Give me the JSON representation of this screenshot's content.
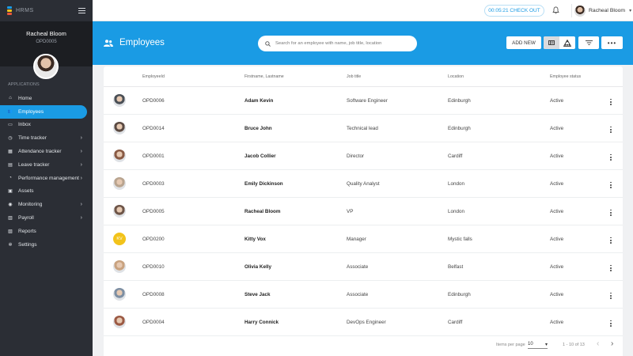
{
  "app": {
    "name": "HRMS"
  },
  "profile": {
    "name": "Racheal Bloom",
    "id": "OPD0005"
  },
  "sidebar": {
    "section": "APPLICATIONS",
    "items": [
      {
        "label": "Home",
        "icon": "home-icon",
        "arrow": false,
        "active": false
      },
      {
        "label": "Employees",
        "icon": "people-icon",
        "arrow": false,
        "active": true
      },
      {
        "label": "Inbox",
        "icon": "inbox-icon",
        "arrow": false,
        "active": false
      },
      {
        "label": "Time tracker",
        "icon": "clock-icon",
        "arrow": true,
        "active": false
      },
      {
        "label": "Attendance tracker",
        "icon": "calendar-icon",
        "arrow": true,
        "active": false
      },
      {
        "label": "Leave tracker",
        "icon": "leave-icon",
        "arrow": true,
        "active": false
      },
      {
        "label": "Performance management",
        "icon": "performance-icon",
        "arrow": true,
        "active": false
      },
      {
        "label": "Assets",
        "icon": "assets-icon",
        "arrow": false,
        "active": false
      },
      {
        "label": "Monitoring",
        "icon": "eye-icon",
        "arrow": true,
        "active": false
      },
      {
        "label": "Payroll",
        "icon": "payroll-icon",
        "arrow": true,
        "active": false
      },
      {
        "label": "Reports",
        "icon": "reports-icon",
        "arrow": false,
        "active": false
      },
      {
        "label": "Settings",
        "icon": "gear-icon",
        "arrow": false,
        "active": false
      }
    ]
  },
  "topbar": {
    "checkout_time": "00:05:21",
    "checkout_label": "CHECK OUT",
    "user_name": "Racheal Bloom"
  },
  "header": {
    "title": "Employees",
    "search_placeholder": "Search for an employee with name, job title, location",
    "add_new": "ADD NEW"
  },
  "table": {
    "headers": [
      "EmployeeId",
      "Firstname, Lastname",
      "Job title",
      "Location",
      "Employee status"
    ],
    "rows": [
      {
        "id": "OPD0006",
        "name": "Adam Kevin",
        "job": "Software Engineer",
        "location": "Edinburgh",
        "status": "Active",
        "avatar_color": "#4a4f55",
        "initials": ""
      },
      {
        "id": "OPD0014",
        "name": "Bruce John",
        "job": "Technical lead",
        "location": "Edinburgh",
        "status": "Active",
        "avatar_color": "#5b4a42",
        "initials": ""
      },
      {
        "id": "OPD0001",
        "name": "Jacob Collier",
        "job": "Director",
        "location": "Cardiff",
        "status": "Active",
        "avatar_color": "#8a5b45",
        "initials": ""
      },
      {
        "id": "OPD0003",
        "name": "Emily Dickinson",
        "job": "Quality Analyst",
        "location": "London",
        "status": "Active",
        "avatar_color": "#b9a48f",
        "initials": ""
      },
      {
        "id": "OPD0005",
        "name": "Racheal Bloom",
        "job": "VP",
        "location": "London",
        "status": "Active",
        "avatar_color": "#6e5548",
        "initials": ""
      },
      {
        "id": "OPD0200",
        "name": "Kitty Vox",
        "job": "Manager",
        "location": "Mystic falls",
        "status": "Active",
        "avatar_color": "#f2c31b",
        "initials": "KV"
      },
      {
        "id": "OPD0010",
        "name": "Olivia Kelly",
        "job": "Associate",
        "location": "Belfast",
        "status": "Active",
        "avatar_color": "#c9a27f",
        "initials": ""
      },
      {
        "id": "OPD0008",
        "name": "Steve Jack",
        "job": "Associate",
        "location": "Edinburgh",
        "status": "Active",
        "avatar_color": "#7d8fa3",
        "initials": ""
      },
      {
        "id": "OPD0004",
        "name": "Harry Connick",
        "job": "DevOps Engineer",
        "location": "Cardiff",
        "status": "Active",
        "avatar_color": "#9c5a44",
        "initials": ""
      }
    ]
  },
  "pagination": {
    "items_label": "Items per page",
    "page_size": "10",
    "range": "1 - 10 of 13"
  },
  "colors": {
    "accent": "#1a9be4",
    "sidebar": "#2b2e35"
  }
}
